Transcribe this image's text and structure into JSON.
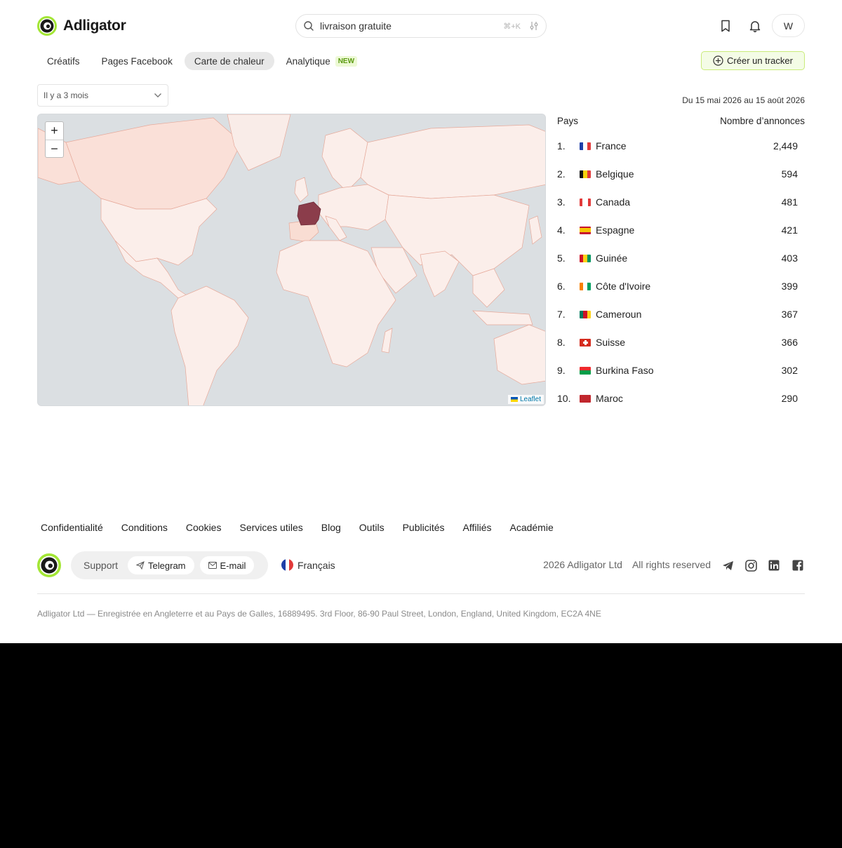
{
  "brand": {
    "name": "Adligator",
    "accent": "#a3e635"
  },
  "search": {
    "value": "livraison gratuite",
    "shortcut": "⌘+K"
  },
  "header": {
    "avatar_letter": "W",
    "icons": [
      "bookmark-icon",
      "bell-icon"
    ]
  },
  "tabs": [
    {
      "label": "Créatifs"
    },
    {
      "label": "Pages Facebook"
    },
    {
      "label": "Carte de chaleur",
      "active": true
    },
    {
      "label": "Analytique",
      "badge": "NEW"
    }
  ],
  "create_tracker": {
    "label": "Créer un tracker"
  },
  "period": {
    "selected": "Il y a 3 mois"
  },
  "date_range": "Du 15 mai 2026 au 15 août 2026",
  "map": {
    "zoom_in": "+",
    "zoom_out": "−",
    "attribution": "Leaflet",
    "highlight_color": "#8b3d4b",
    "low_color": "#fbe3dc",
    "ocean_color": "#dbdfe2"
  },
  "country_table": {
    "col_country": "Pays",
    "col_count": "Nombre d’annonces",
    "rows": [
      {
        "rank": "1.",
        "name": "France",
        "count": "2,449"
      },
      {
        "rank": "2.",
        "name": "Belgique",
        "count": "594"
      },
      {
        "rank": "3.",
        "name": "Canada",
        "count": "481"
      },
      {
        "rank": "4.",
        "name": "Espagne",
        "count": "421"
      },
      {
        "rank": "5.",
        "name": "Guinée",
        "count": "403"
      },
      {
        "rank": "6.",
        "name": "Côte d'Ivoire",
        "count": "399"
      },
      {
        "rank": "7.",
        "name": "Cameroun",
        "count": "367"
      },
      {
        "rank": "8.",
        "name": "Suisse",
        "count": "366"
      },
      {
        "rank": "9.",
        "name": "Burkina Faso",
        "count": "302"
      },
      {
        "rank": "10.",
        "name": "Maroc",
        "count": "290"
      }
    ]
  },
  "footer": {
    "links": [
      "Confidentialité",
      "Conditions",
      "Cookies",
      "Services utiles",
      "Blog",
      "Outils",
      "Publicités",
      "Affiliés",
      "Académie"
    ],
    "support_label": "Support",
    "telegram": "Telegram",
    "email": "E-mail",
    "language": "Français",
    "copyright": "2026 Adligator Ltd",
    "rights": "All rights reserved",
    "legal": "Adligator Ltd — Enregistrée en Angleterre et au Pays de Galles, 16889495. 3rd Floor, 86-90 Paul Street, London, England, United Kingdom, EC2A 4NE",
    "social_icons": [
      "telegram-icon",
      "instagram-icon",
      "linkedin-icon",
      "facebook-icon"
    ]
  }
}
